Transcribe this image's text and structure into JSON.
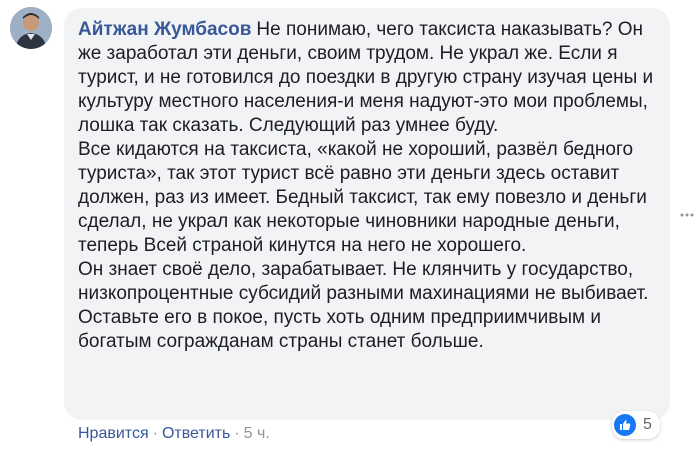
{
  "comment": {
    "author": "Айтжан Жумбасов",
    "paragraphs": [
      "Не понимаю, чего таксиста наказывать? Он же заработал эти деньги, своим трудом. Не украл же. Если я турист, и не готовился до поездки в другую страну изучая цены и культуру местного населения-и меня надуют-это мои проблемы, лошка так сказать. Следующий раз умнее буду.",
      "Все кидаются на таксиста, «какой не хороший, развёл бедного туриста», так этот турист всё равно эти деньги здесь оставит должен, раз из имеет. Бедный таксист, так ему повезло и деньги сделал, не украл как некоторые чиновники народные деньги, теперь Всей страной кинутся на него не хорошего.",
      "Он знает своё дело, зарабатывает. Не клянчить у государство, низкопроцентные субсидий разными махинациями не выбивает. Оставьте его в покое, пусть хоть одним предприимчивым и богатым согражданам страны станет больше."
    ],
    "reaction_count": "5"
  },
  "actions": {
    "like": "Нравится",
    "reply": "Ответить",
    "time": "5 ч.",
    "separator": "·"
  },
  "icons": {
    "like": "thumbs-up-icon",
    "more": "more-options-icon",
    "avatar": "avatar"
  },
  "colors": {
    "author": "#385898",
    "bubble": "#f2f3f5",
    "like": "#1877f2",
    "muted": "#90949c"
  }
}
